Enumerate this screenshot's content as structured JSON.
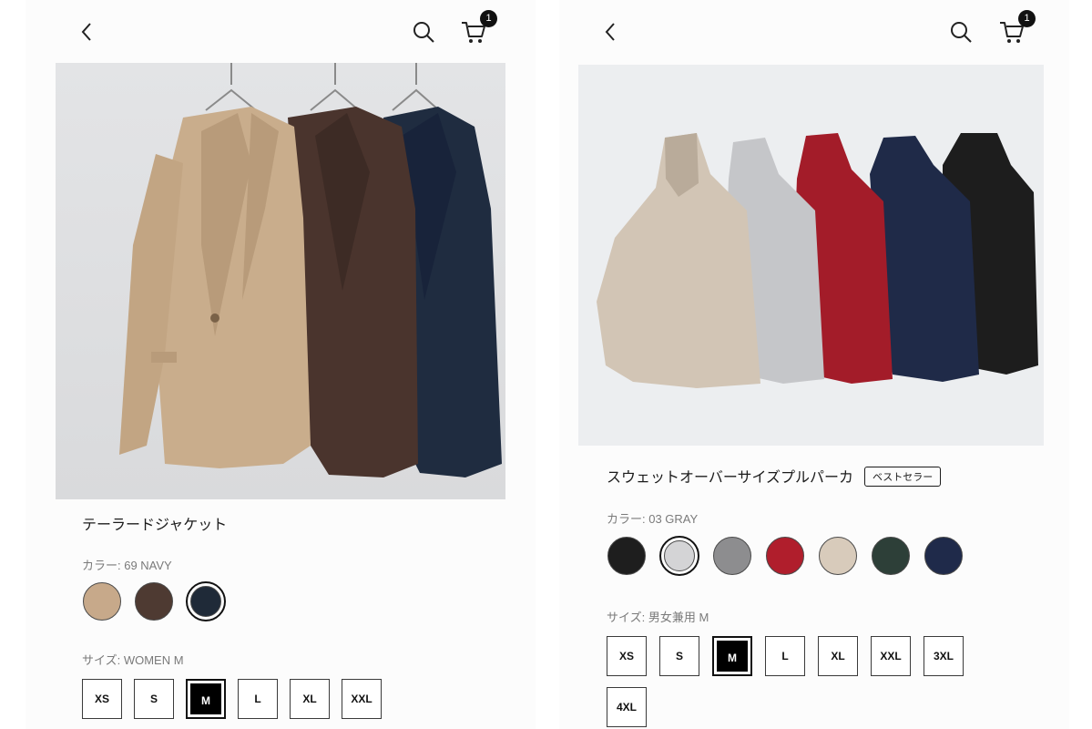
{
  "left": {
    "cart_count": "1",
    "product_title": "テーラードジャケット",
    "color_label": "カラー: 69 NAVY",
    "size_label": "サイズ: WOMEN M",
    "colors": [
      {
        "name": "beige",
        "hex": "#c7a98a",
        "selected": false
      },
      {
        "name": "brown",
        "hex": "#4e3a32",
        "selected": false
      },
      {
        "name": "navy",
        "hex": "#1f2a38",
        "selected": true
      }
    ],
    "sizes": [
      "XS",
      "S",
      "M",
      "L",
      "XL",
      "XXL"
    ],
    "selected_size": "M"
  },
  "right": {
    "cart_count": "1",
    "product_title": "スウェットオーバーサイズプルパーカ",
    "badge": "ベストセラー",
    "color_label": "カラー: 03 GRAY",
    "size_label": "サイズ: 男女兼用 M",
    "colors": [
      {
        "name": "black",
        "hex": "#1e1e1e",
        "selected": false
      },
      {
        "name": "light-gray",
        "hex": "#d4d4d6",
        "selected": true
      },
      {
        "name": "gray",
        "hex": "#8d8d8f",
        "selected": false
      },
      {
        "name": "red",
        "hex": "#b01e2c",
        "selected": false
      },
      {
        "name": "beige",
        "hex": "#d8cbbb",
        "selected": false
      },
      {
        "name": "dark-green",
        "hex": "#2d3f38",
        "selected": false
      },
      {
        "name": "navy",
        "hex": "#1f2a4a",
        "selected": false
      }
    ],
    "sizes": [
      "XS",
      "S",
      "M",
      "L",
      "XL",
      "XXL",
      "3XL",
      "4XL"
    ],
    "selected_size": "M"
  },
  "icons": [
    "back-arrow-icon",
    "search-icon",
    "cart-icon"
  ]
}
